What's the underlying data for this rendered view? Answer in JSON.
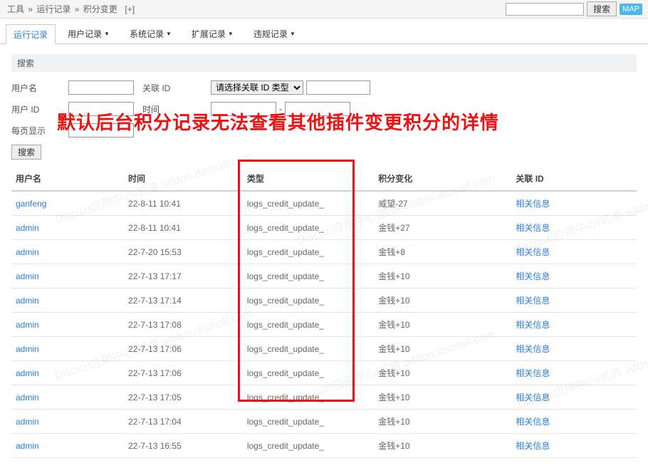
{
  "breadcrumb": {
    "p1": "工具",
    "p2": "运行记录",
    "p3": "积分变更",
    "plus": "[+]"
  },
  "topSearch": {
    "placeholder": "",
    "btn": "搜索",
    "map": "MAP"
  },
  "tabs": [
    {
      "label": "运行记录",
      "active": true,
      "has_caret": false
    },
    {
      "label": "用户记录",
      "active": false,
      "has_caret": true
    },
    {
      "label": "系统记录",
      "active": false,
      "has_caret": true
    },
    {
      "label": "扩展记录",
      "active": false,
      "has_caret": true
    },
    {
      "label": "违规记录",
      "active": false,
      "has_caret": true
    }
  ],
  "sectionHeader": "搜索",
  "filters": {
    "username_label": "用户名",
    "relid_label": "关联 ID",
    "relid_select": "请选择关联 ID 类型 ▼",
    "userid_label": "用户 ID",
    "time_label": "时间",
    "dash": "-",
    "perpage_label": "每页显示",
    "search_btn": "搜索"
  },
  "overlayText": "默认后台积分记录无法查看其他插件变更积分的详情",
  "columns": {
    "c1": "用户名",
    "c2": "时间",
    "c3": "类型",
    "c4": "积分变化",
    "c5": "关联 ID"
  },
  "linkText": "相关信息",
  "rows": [
    {
      "user": "ganfeng",
      "time": "22-8-11 10:41",
      "type": "logs_credit_update_",
      "change": "威望-27"
    },
    {
      "user": "admin",
      "time": "22-8-11 10:41",
      "type": "logs_credit_update_",
      "change": "金钱+27"
    },
    {
      "user": "admin",
      "time": "22-7-20 15:53",
      "type": "logs_credit_update_",
      "change": "金钱+8"
    },
    {
      "user": "admin",
      "time": "22-7-13 17:17",
      "type": "logs_credit_update_",
      "change": "金钱+10"
    },
    {
      "user": "admin",
      "time": "22-7-13 17:14",
      "type": "logs_credit_update_",
      "change": "金钱+10"
    },
    {
      "user": "admin",
      "time": "22-7-13 17:08",
      "type": "logs_credit_update_",
      "change": "金钱+10"
    },
    {
      "user": "admin",
      "time": "22-7-13 17:06",
      "type": "logs_credit_update_",
      "change": "金钱+10"
    },
    {
      "user": "admin",
      "time": "22-7-13 17:06",
      "type": "logs_credit_update_",
      "change": "金钱+10"
    },
    {
      "user": "admin",
      "time": "22-7-13 17:05",
      "type": "logs_credit_update_",
      "change": "金钱+10"
    },
    {
      "user": "admin",
      "time": "22-7-13 17:04",
      "type": "logs_credit_update_",
      "change": "金钱+10"
    },
    {
      "user": "admin",
      "time": "22-7-13 16:55",
      "type": "logs_credit_update_",
      "change": "金钱+10"
    }
  ],
  "watermarkText": "Discuz!应用中心|贰道 addon.dismall.com"
}
